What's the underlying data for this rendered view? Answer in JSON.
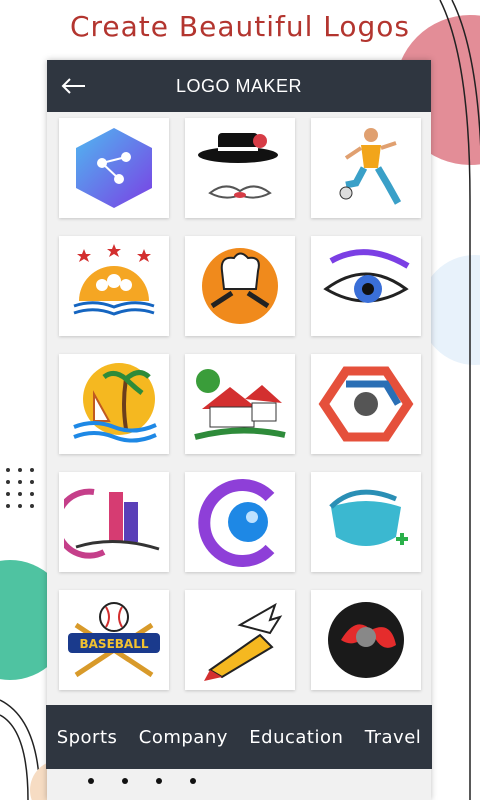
{
  "promo": {
    "headline": "Create Beautiful Logos"
  },
  "appbar": {
    "title": "LOGO MAKER",
    "back_icon": "arrow-left-icon"
  },
  "logos": [
    {
      "name": "tech-hexagon-logo",
      "icon": "hexagon-circuit-icon"
    },
    {
      "name": "chef-hat-mustache-logo",
      "icon": "hat-mustache-icon"
    },
    {
      "name": "soccer-player-logo",
      "icon": "soccer-player-icon"
    },
    {
      "name": "education-book-sun-logo",
      "icon": "book-sun-icon"
    },
    {
      "name": "chef-spoon-fork-logo",
      "icon": "chef-hat-icon"
    },
    {
      "name": "eye-lash-logo",
      "icon": "eye-icon"
    },
    {
      "name": "travel-beach-logo",
      "icon": "palm-boat-icon"
    },
    {
      "name": "real-estate-house-logo",
      "icon": "house-icon"
    },
    {
      "name": "tech-hexagon-eye-logo",
      "icon": "hexagon-eye-icon"
    },
    {
      "name": "building-swoosh-logo",
      "icon": "buildings-icon"
    },
    {
      "name": "letter-c-sphere-logo",
      "icon": "letter-c-icon"
    },
    {
      "name": "medical-mask-logo",
      "icon": "mask-plus-icon"
    },
    {
      "name": "baseball-badge-logo",
      "icon": "baseball-icon",
      "text": "BASEBALL"
    },
    {
      "name": "winged-pencil-logo",
      "icon": "winged-pencil-icon"
    },
    {
      "name": "red-sphere-logo",
      "icon": "sphere-icon"
    }
  ],
  "tabs": [
    {
      "label": "Sports"
    },
    {
      "label": "Company"
    },
    {
      "label": "Education"
    },
    {
      "label": "Travel"
    }
  ],
  "colors": {
    "appbar": "#2f3640",
    "headline": "#b3352f",
    "accent_pink": "#e07a86",
    "accent_green": "#4fc3a1"
  }
}
